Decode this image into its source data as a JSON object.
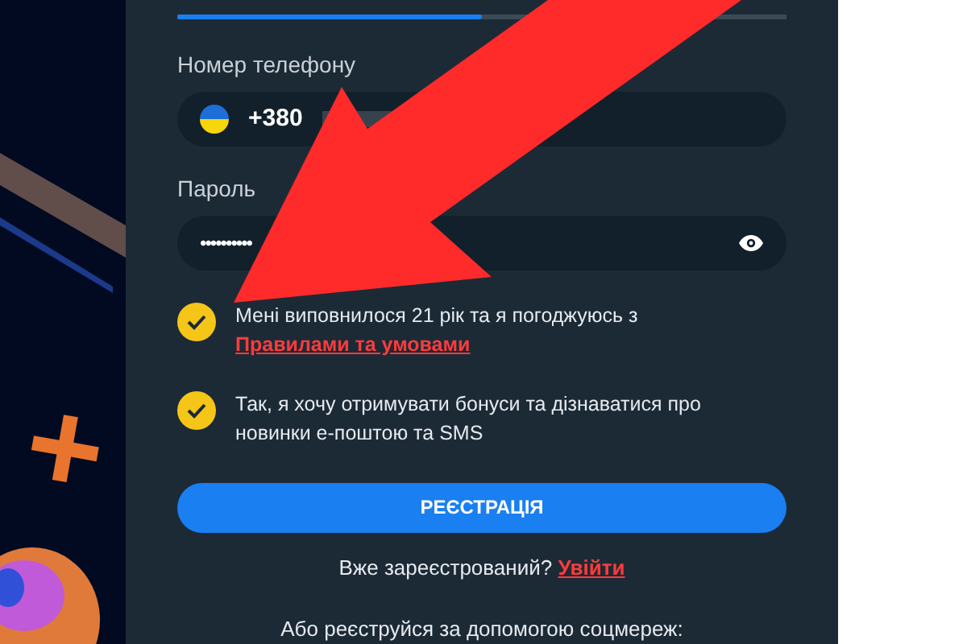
{
  "progress": {
    "level": 0.5
  },
  "phone": {
    "label": "Номер телефону",
    "value": "+380"
  },
  "password": {
    "label": "Пароль",
    "value": "••••••••••"
  },
  "consents": [
    {
      "text": "Мені виповнилося 21 рік та я погоджуюсь з ",
      "link": "Правилами та умовами",
      "checked": true
    },
    {
      "text": "Так, я хочу отримувати бонуси та дізнаватися про новинки е-поштою та SMS",
      "checked": true
    }
  ],
  "register_button": "РЕЄСТРАЦІЯ",
  "login_prompt": {
    "text": "Вже зареєстрований? ",
    "link": "Увійти"
  },
  "social_prompt": "Або реєструйся за допомогою соцмереж:"
}
